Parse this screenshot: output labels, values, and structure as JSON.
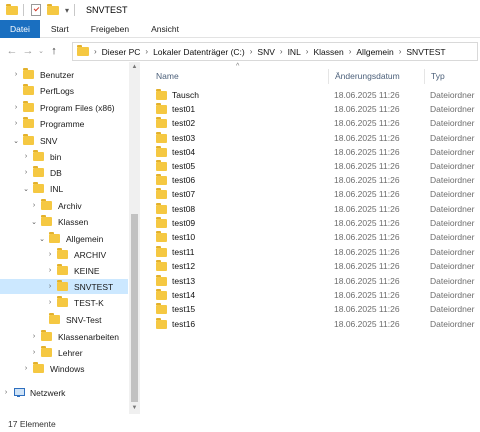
{
  "window": {
    "title": "SNVTEST"
  },
  "ribbon": {
    "tabs": [
      "Datei",
      "Start",
      "Freigeben",
      "Ansicht"
    ]
  },
  "address": {
    "crumbs": [
      "Dieser PC",
      "Lokaler Datenträger (C:)",
      "SNV",
      "INL",
      "Klassen",
      "Allgemein",
      "SNVTEST"
    ]
  },
  "nav": {
    "items": [
      {
        "label": "Benutzer",
        "chevron": "›"
      },
      {
        "label": "PerfLogs",
        "chevron": ""
      },
      {
        "label": "Program Files (x86)",
        "chevron": "›"
      },
      {
        "label": "Programme",
        "chevron": "›"
      },
      {
        "label": "SNV",
        "chevron": "⌄"
      },
      {
        "label": "bin",
        "chevron": "›"
      },
      {
        "label": "DB",
        "chevron": "›"
      },
      {
        "label": "INL",
        "chevron": "⌄"
      },
      {
        "label": "Archiv",
        "chevron": "›"
      },
      {
        "label": "Klassen",
        "chevron": "⌄"
      },
      {
        "label": "Allgemein",
        "chevron": "⌄"
      },
      {
        "label": "ARCHIV",
        "chevron": "›"
      },
      {
        "label": "KEINE",
        "chevron": "›"
      },
      {
        "label": "SNVTEST",
        "chevron": "›"
      },
      {
        "label": "TEST-K",
        "chevron": "›"
      },
      {
        "label": "SNV-Test",
        "chevron": ""
      },
      {
        "label": "Klassenarbeiten",
        "chevron": "›"
      },
      {
        "label": "Lehrer",
        "chevron": "›"
      },
      {
        "label": "Windows",
        "chevron": "›"
      },
      {
        "label": "Netzwerk",
        "chevron": "›"
      }
    ]
  },
  "columns": {
    "name": "Name",
    "date": "Änderungsdatum",
    "type": "Typ"
  },
  "files": [
    {
      "name": "Tausch",
      "date": "18.06.2025 11:26",
      "type": "Dateiordner"
    },
    {
      "name": "test01",
      "date": "18.06.2025 11:26",
      "type": "Dateiordner"
    },
    {
      "name": "test02",
      "date": "18.06.2025 11:26",
      "type": "Dateiordner"
    },
    {
      "name": "test03",
      "date": "18.06.2025 11:26",
      "type": "Dateiordner"
    },
    {
      "name": "test04",
      "date": "18.06.2025 11:26",
      "type": "Dateiordner"
    },
    {
      "name": "test05",
      "date": "18.06.2025 11:26",
      "type": "Dateiordner"
    },
    {
      "name": "test06",
      "date": "18.06.2025 11:26",
      "type": "Dateiordner"
    },
    {
      "name": "test07",
      "date": "18.06.2025 11:26",
      "type": "Dateiordner"
    },
    {
      "name": "test08",
      "date": "18.06.2025 11:26",
      "type": "Dateiordner"
    },
    {
      "name": "test09",
      "date": "18.06.2025 11:26",
      "type": "Dateiordner"
    },
    {
      "name": "test10",
      "date": "18.06.2025 11:26",
      "type": "Dateiordner"
    },
    {
      "name": "test11",
      "date": "18.06.2025 11:26",
      "type": "Dateiordner"
    },
    {
      "name": "test12",
      "date": "18.06.2025 11:26",
      "type": "Dateiordner"
    },
    {
      "name": "test13",
      "date": "18.06.2025 11:26",
      "type": "Dateiordner"
    },
    {
      "name": "test14",
      "date": "18.06.2025 11:26",
      "type": "Dateiordner"
    },
    {
      "name": "test15",
      "date": "18.06.2025 11:26",
      "type": "Dateiordner"
    },
    {
      "name": "test16",
      "date": "18.06.2025 11:26",
      "type": "Dateiordner"
    }
  ],
  "status": {
    "count": "17 Elemente"
  },
  "colors": {
    "file_tab": "#1a6fc0",
    "selection": "#cce8ff",
    "folder": "#f5c842"
  }
}
